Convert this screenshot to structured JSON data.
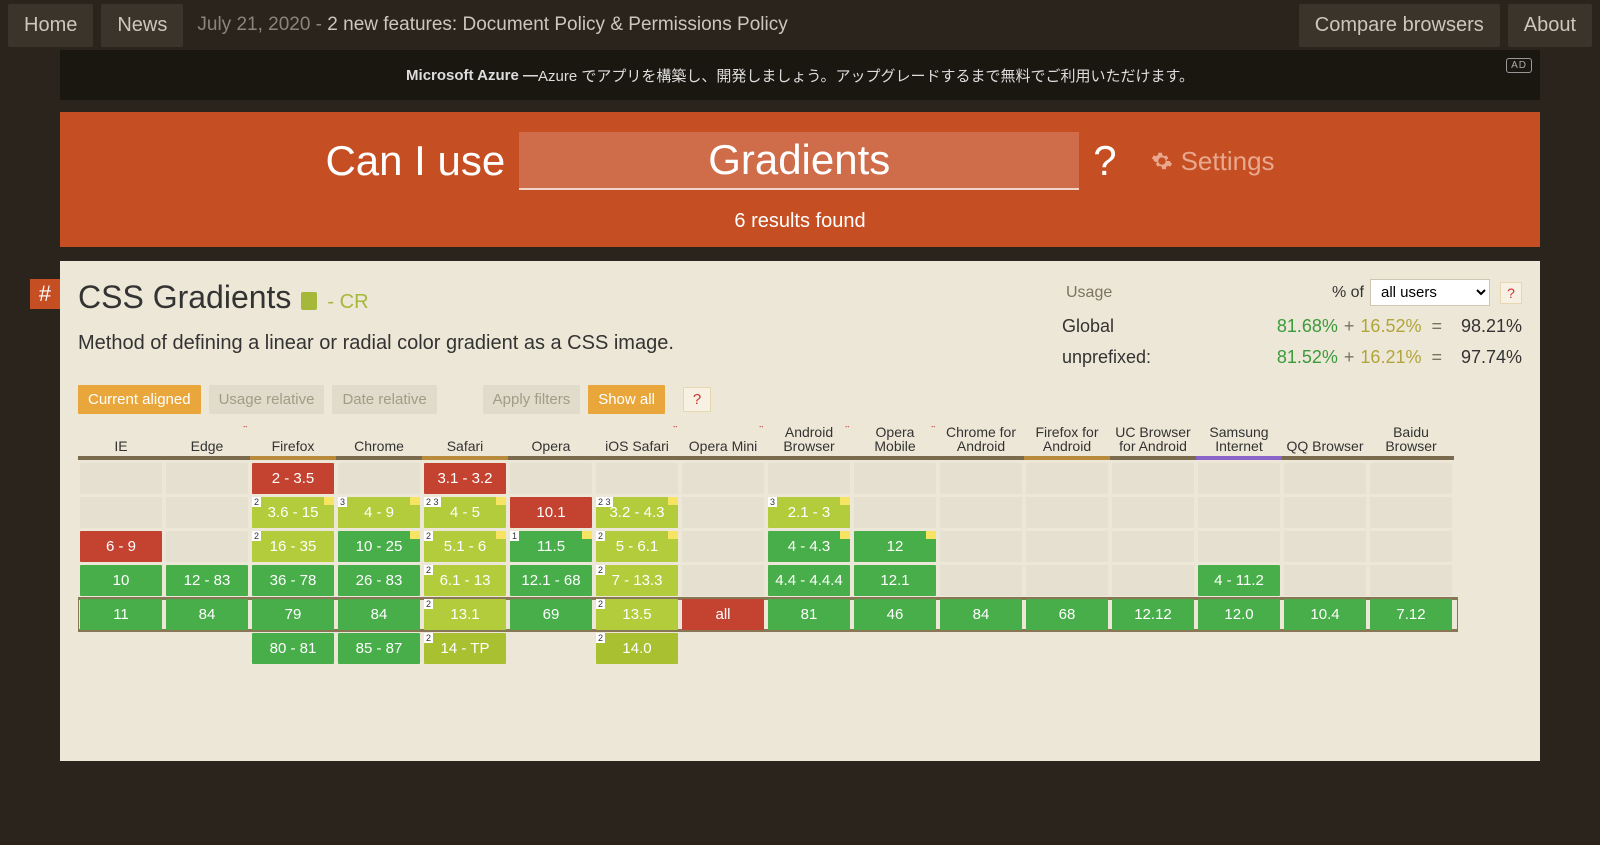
{
  "topbar": {
    "home": "Home",
    "news": "News",
    "date": "July 21, 2020 - ",
    "news_link": "2 new features: Document Policy & Permissions Policy",
    "compare": "Compare browsers",
    "about": "About"
  },
  "ad": {
    "sponsor": "Microsoft Azure — ",
    "text": "Azure でアプリを構築し、開発しましょう。アップグレードするまで無料でご利用いただけます。",
    "tag": "AD"
  },
  "hero": {
    "label": "Can I use",
    "input_value": "Gradients",
    "q": "?",
    "settings": "Settings",
    "results": "6 results found"
  },
  "feature": {
    "title": "CSS Gradients",
    "status": "- CR",
    "description": "Method of defining a linear or radial color gradient as a CSS image."
  },
  "usage": {
    "label": "Usage",
    "pct_of": "% of",
    "select_value": "all users",
    "help": "?",
    "rows": [
      {
        "label": "Global",
        "full": "81.68%",
        "plus": "+",
        "partial": "16.52%",
        "eq": "=",
        "total": "98.21%"
      },
      {
        "label": "unprefixed:",
        "full": "81.52%",
        "plus": "+",
        "partial": "16.21%",
        "eq": "=",
        "total": "97.74%"
      }
    ]
  },
  "toggles": {
    "current_aligned": "Current aligned",
    "usage_relative": "Usage relative",
    "date_relative": "Date relative",
    "apply_filters": "Apply filters",
    "show_all": "Show all",
    "help": "?"
  },
  "hash": "#",
  "browsers": [
    {
      "name": "IE",
      "star": false,
      "border": ""
    },
    {
      "name": "Edge",
      "star": true,
      "border": ""
    },
    {
      "name": "Firefox",
      "star": false,
      "border": "alt"
    },
    {
      "name": "Chrome",
      "star": false,
      "border": ""
    },
    {
      "name": "Safari",
      "star": false,
      "border": "alt"
    },
    {
      "name": "Opera",
      "star": false,
      "border": ""
    },
    {
      "name": "iOS Safari",
      "star": true,
      "border": ""
    },
    {
      "name": "Opera Mini",
      "star": true,
      "border": ""
    },
    {
      "name": "Android Browser",
      "star": true,
      "border": ""
    },
    {
      "name": "Opera Mobile",
      "star": true,
      "border": ""
    },
    {
      "name": "Chrome for Android",
      "star": false,
      "border": ""
    },
    {
      "name": "Firefox for Android",
      "star": false,
      "border": "alt"
    },
    {
      "name": "UC Browser for Android",
      "star": false,
      "border": ""
    },
    {
      "name": "Samsung Internet",
      "star": false,
      "border": "sams"
    },
    {
      "name": "QQ Browser",
      "star": false,
      "border": ""
    },
    {
      "name": "Baidu Browser",
      "star": false,
      "border": ""
    }
  ],
  "rows": [
    [
      {
        "t": "empty"
      },
      {
        "t": "empty"
      },
      {
        "t": "n",
        "v": "2 - 3.5"
      },
      {
        "t": "empty"
      },
      {
        "t": "n",
        "v": "3.1 - 3.2"
      },
      {
        "t": "empty"
      },
      {
        "t": "empty"
      },
      {
        "t": "empty"
      },
      {
        "t": "empty"
      },
      {
        "t": "empty"
      },
      {
        "t": "empty"
      },
      {
        "t": "empty"
      },
      {
        "t": "empty"
      },
      {
        "t": "empty"
      },
      {
        "t": "empty"
      },
      {
        "t": "empty"
      }
    ],
    [
      {
        "t": "empty"
      },
      {
        "t": "empty"
      },
      {
        "t": "p",
        "v": "3.6 - 15",
        "note": "2",
        "flag": true
      },
      {
        "t": "p",
        "v": "4 - 9",
        "note": "3",
        "flag": true
      },
      {
        "t": "p",
        "v": "4 - 5",
        "note": "2 3",
        "flag": true
      },
      {
        "t": "n",
        "v": "10.1"
      },
      {
        "t": "p",
        "v": "3.2 - 4.3",
        "note": "2 3",
        "flag": true
      },
      {
        "t": "empty"
      },
      {
        "t": "p",
        "v": "2.1 - 3",
        "note": "3",
        "flag": true
      },
      {
        "t": "empty"
      },
      {
        "t": "empty"
      },
      {
        "t": "empty"
      },
      {
        "t": "empty"
      },
      {
        "t": "empty"
      },
      {
        "t": "empty"
      },
      {
        "t": "empty"
      }
    ],
    [
      {
        "t": "n",
        "v": "6 - 9"
      },
      {
        "t": "empty"
      },
      {
        "t": "p",
        "v": "16 - 35",
        "note": "2"
      },
      {
        "t": "y",
        "v": "10 - 25",
        "flag": true
      },
      {
        "t": "p",
        "v": "5.1 - 6",
        "note": "2",
        "flag": true
      },
      {
        "t": "y",
        "v": "11.5",
        "note": "1",
        "flag": true
      },
      {
        "t": "p",
        "v": "5 - 6.1",
        "note": "2",
        "flag": true
      },
      {
        "t": "empty"
      },
      {
        "t": "y",
        "v": "4 - 4.3",
        "flag": true
      },
      {
        "t": "y",
        "v": "12",
        "flag": true
      },
      {
        "t": "empty"
      },
      {
        "t": "empty"
      },
      {
        "t": "empty"
      },
      {
        "t": "empty"
      },
      {
        "t": "empty"
      },
      {
        "t": "empty"
      }
    ],
    [
      {
        "t": "y",
        "v": "10"
      },
      {
        "t": "y",
        "v": "12 - 83"
      },
      {
        "t": "y",
        "v": "36 - 78"
      },
      {
        "t": "y",
        "v": "26 - 83"
      },
      {
        "t": "p",
        "v": "6.1 - 13",
        "note": "2"
      },
      {
        "t": "y",
        "v": "12.1 - 68"
      },
      {
        "t": "p",
        "v": "7 - 13.3",
        "note": "2"
      },
      {
        "t": "empty"
      },
      {
        "t": "y",
        "v": "4.4 - 4.4.4"
      },
      {
        "t": "y",
        "v": "12.1"
      },
      {
        "t": "empty"
      },
      {
        "t": "empty"
      },
      {
        "t": "empty"
      },
      {
        "t": "y",
        "v": "4 - 11.2"
      },
      {
        "t": "empty"
      },
      {
        "t": "empty"
      }
    ],
    [
      {
        "t": "y",
        "v": "11"
      },
      {
        "t": "y",
        "v": "84"
      },
      {
        "t": "y",
        "v": "79"
      },
      {
        "t": "y",
        "v": "84"
      },
      {
        "t": "p",
        "v": "13.1",
        "note": "2"
      },
      {
        "t": "y",
        "v": "69"
      },
      {
        "t": "p",
        "v": "13.5",
        "note": "2"
      },
      {
        "t": "n",
        "v": "all"
      },
      {
        "t": "y",
        "v": "81"
      },
      {
        "t": "y",
        "v": "46"
      },
      {
        "t": "y",
        "v": "84"
      },
      {
        "t": "y",
        "v": "68"
      },
      {
        "t": "y",
        "v": "12.12"
      },
      {
        "t": "y",
        "v": "12.0"
      },
      {
        "t": "y",
        "v": "10.4"
      },
      {
        "t": "y",
        "v": "7.12"
      }
    ],
    [
      {
        "t": "blank"
      },
      {
        "t": "blank"
      },
      {
        "t": "y",
        "v": "80 - 81"
      },
      {
        "t": "y",
        "v": "85 - 87"
      },
      {
        "t": "p2",
        "v": "14 - TP",
        "note": "2"
      },
      {
        "t": "blank"
      },
      {
        "t": "p2",
        "v": "14.0",
        "note": "2"
      },
      {
        "t": "blank"
      },
      {
        "t": "blank"
      },
      {
        "t": "blank"
      },
      {
        "t": "blank"
      },
      {
        "t": "blank"
      },
      {
        "t": "blank"
      },
      {
        "t": "blank"
      },
      {
        "t": "blank"
      },
      {
        "t": "blank"
      }
    ]
  ]
}
